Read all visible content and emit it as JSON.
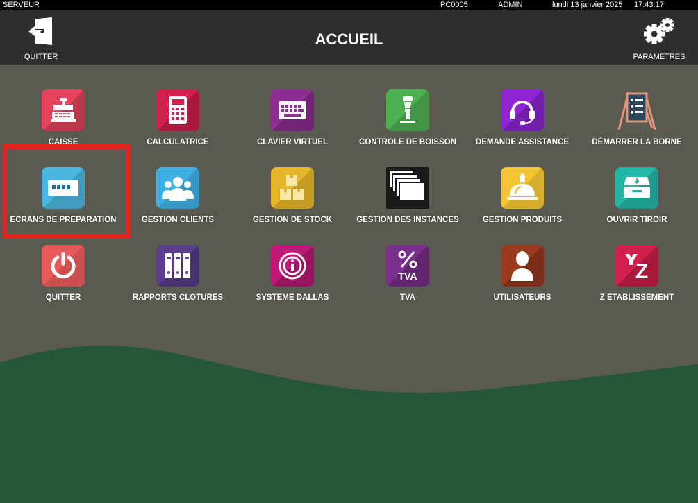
{
  "statusbar": {
    "user": "SERVEUR",
    "machine": "PC0005",
    "role": "ADMIN",
    "date": "lundi 13 janvier 2025",
    "time": "17:43:17"
  },
  "header": {
    "title": "ACCUEIL",
    "quit_label": "QUITTER",
    "settings_label": "PARAMETRES"
  },
  "colors": {
    "background": "#5b5a50",
    "header": "#2e2e2e",
    "wave": "#255638",
    "highlight": "#e4241f"
  },
  "tiles": [
    {
      "label": "CAISSE",
      "icon": "cash-register-icon",
      "color": "#e6435e"
    },
    {
      "label": "CALCULATRICE",
      "icon": "calculator-icon",
      "color": "#d31f4d"
    },
    {
      "label": "CLAVIER VIRTUEL",
      "icon": "keyboard-icon",
      "color": "#8e2e93"
    },
    {
      "label": "CONTROLE DE BOISSON",
      "icon": "beer-tap-icon",
      "color": "#4caf50"
    },
    {
      "label": "DEMANDE ASSISTANCE",
      "icon": "headset-icon",
      "color": "#8e24d6"
    },
    {
      "label": "DÉMARRER LA BORNE",
      "icon": "menu-board-icon",
      "color": "none"
    },
    {
      "label": "ECRANS DE PREPARATION",
      "icon": "preparation-screen-icon",
      "color": "#4bb6e0"
    },
    {
      "label": "GESTION CLIENTS",
      "icon": "users-group-icon",
      "color": "#3fb0e6"
    },
    {
      "label": "GESTION DE STOCK",
      "icon": "boxes-icon",
      "color": "#e7b628"
    },
    {
      "label": "GESTION DES INSTANCES",
      "icon": "stacked-windows-icon",
      "color": "#1a1a1a"
    },
    {
      "label": "GESTION PRODUITS",
      "icon": "cloche-icon",
      "color": "#f3c533"
    },
    {
      "label": "OUVRIR TIROIR",
      "icon": "drawer-icon",
      "color": "#22b6a8"
    },
    {
      "label": "QUITTER",
      "icon": "power-icon",
      "color": "#e85a5a"
    },
    {
      "label": "RAPPORTS CLOTURES",
      "icon": "binders-icon",
      "color": "#5b3f8e"
    },
    {
      "label": "SYSTEME DALLAS",
      "icon": "dallas-key-icon",
      "color": "#c0197a"
    },
    {
      "label": "TVA",
      "icon": "percent-icon",
      "color": "#7b2f8d",
      "icon_text": "TVA"
    },
    {
      "label": "UTILISATEURS",
      "icon": "user-icon",
      "color": "#9c3a1f"
    },
    {
      "label": "Z ETABLISSEMENT",
      "icon": "z-report-icon",
      "color": "#d21f4b",
      "icon_text": "Z"
    }
  ]
}
